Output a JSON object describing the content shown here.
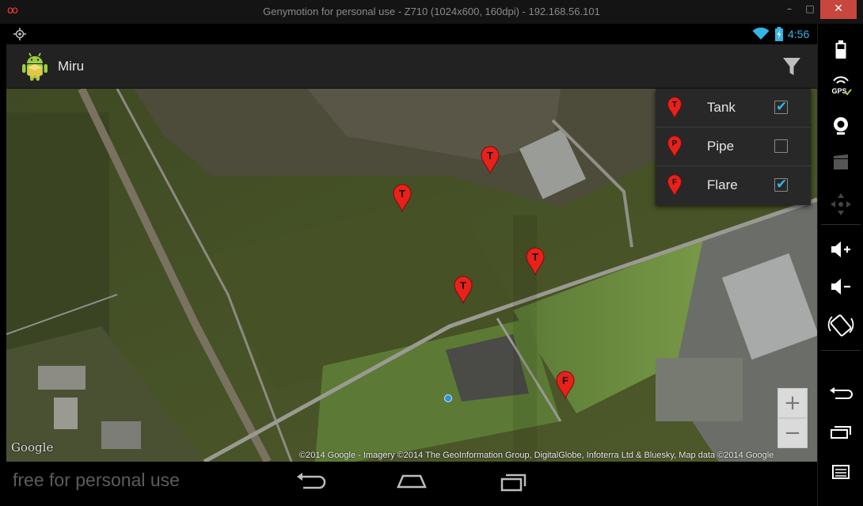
{
  "window": {
    "logo": "oo",
    "title": "Genymotion for personal use - Z710 (1024x600, 160dpi) - 192.168.56.101",
    "minimize": "–",
    "maximize": "□",
    "close": "✕"
  },
  "status_bar": {
    "time": "4:56",
    "icons": [
      "gps-icon",
      "wifi-icon",
      "battery-charging-icon"
    ],
    "accent_color": "#33b5e5"
  },
  "action_bar": {
    "title": "Miru",
    "app_icon": "android-icon",
    "action_icon": "filter-icon"
  },
  "filter_menu": {
    "items": [
      {
        "label": "Tank",
        "pin_letter": "T",
        "checked": true
      },
      {
        "label": "Pipe",
        "pin_letter": "P",
        "checked": false
      },
      {
        "label": "Flare",
        "pin_letter": "F",
        "checked": true
      }
    ],
    "check_color": "#33b5e5"
  },
  "map": {
    "markers": [
      {
        "letter": "T",
        "type": "Tank"
      },
      {
        "letter": "T",
        "type": "Tank"
      },
      {
        "letter": "T",
        "type": "Tank"
      },
      {
        "letter": "T",
        "type": "Tank"
      },
      {
        "letter": "F",
        "type": "Flare"
      }
    ],
    "marker_color": "#e8211b",
    "logo": "Google",
    "attribution": "©2014 Google - Imagery ©2014 The GeoInformation Group, DigitalGlobe, Infoterra Ltd & Bluesky, Map data ©2014 Google",
    "zoom_in": "+",
    "zoom_out": "−"
  },
  "nav_bar": {
    "watermark": "free for personal use",
    "buttons": [
      "back-icon",
      "home-icon",
      "recent-apps-icon"
    ]
  },
  "side_toolbar": {
    "buttons": [
      "battery-icon",
      "gps-icon",
      "camera-icon",
      "video-icon",
      "dpad-icon",
      "volume-up-icon",
      "volume-down-icon",
      "rotate-icon",
      "back-icon",
      "recent-apps-icon",
      "menu-icon"
    ]
  }
}
